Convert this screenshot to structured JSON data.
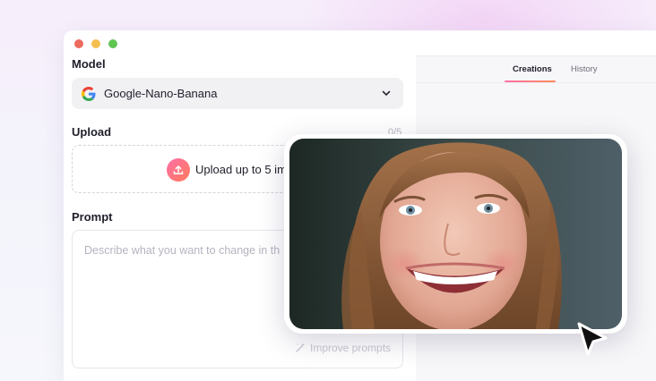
{
  "window": {
    "dots": [
      "#ed6a5e",
      "#f5bf4f",
      "#61c554"
    ]
  },
  "model": {
    "label": "Model",
    "selected": "Google-Nano-Banana",
    "icon": "google-g-icon"
  },
  "upload": {
    "label": "Upload",
    "counter": "0/5",
    "cta": "Upload up to 5 im"
  },
  "prompt": {
    "label": "Prompt",
    "placeholder": "Describe what you want to change in th",
    "improve_label": "Improve prompts"
  },
  "tabs": [
    {
      "label": "Creations",
      "active": true
    },
    {
      "label": "History",
      "active": false
    }
  ],
  "colors": {
    "accent_start": "#ff6fa7",
    "accent_end": "#ff7a5a"
  }
}
